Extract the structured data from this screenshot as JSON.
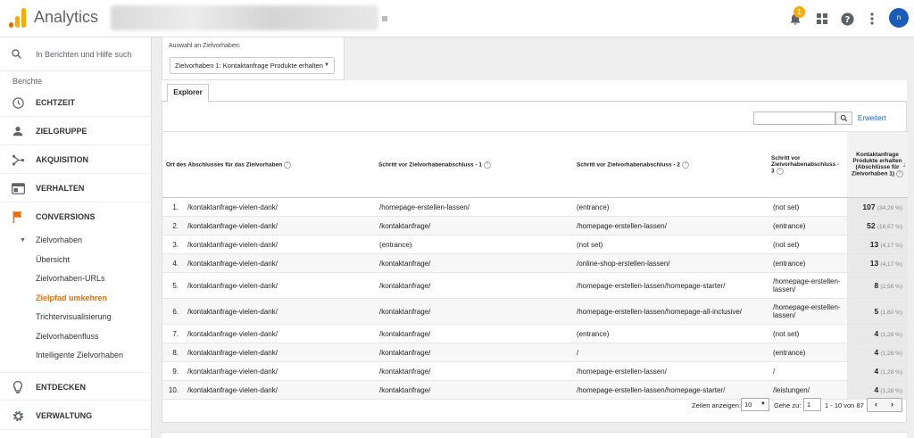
{
  "header": {
    "app_title": "Analytics",
    "notification_count": "1",
    "avatar_text": "n"
  },
  "sidebar": {
    "search_placeholder": "In Berichten und Hilfe such",
    "section_label": "Berichte",
    "items": [
      {
        "label": "ECHTZEIT",
        "icon": "clock-icon"
      },
      {
        "label": "ZIELGRUPPE",
        "icon": "person-icon"
      },
      {
        "label": "AKQUISITION",
        "icon": "acquisition-icon"
      },
      {
        "label": "VERHALTEN",
        "icon": "behavior-icon"
      },
      {
        "label": "CONVERSIONS",
        "icon": "flag-icon"
      }
    ],
    "conversions_sub": {
      "group_label": "Zielvorhaben",
      "items": [
        "Übersicht",
        "Zielvorhaben-URLs",
        "Zielpfad umkehren",
        "Trichtervisualisierung",
        "Zielvorhabenfluss",
        "Intelligente Zielvorhaben"
      ],
      "active_index": 2
    },
    "bottom_items": [
      {
        "label": "ENTDECKEN",
        "icon": "lightbulb-icon"
      },
      {
        "label": "VERWALTUNG",
        "icon": "gear-icon"
      }
    ]
  },
  "goal_selector": {
    "label": "Auswahl an Zielvorhaben:",
    "value": "Zielvorhaben 1: Kontaktanfrage Produkte erhalten"
  },
  "tabs": {
    "explorer": "Explorer"
  },
  "table_tools": {
    "advanced_link": "Erweitert"
  },
  "table": {
    "columns": [
      "Ort des Abschlusses für das Zielvorhaben",
      "Schritt vor Zielvorhabenabschluss - 1",
      "Schritt vor Zielvorhabenabschluss - 2",
      "Schritt vor Zielvorhabenabschluss - 3",
      "Kontaktanfrage Produkte erhalten (Abschlüsse für Zielvorhaben 1)"
    ],
    "rows": [
      {
        "idx": "1.",
        "c1": "/kontaktanfrage-vielen-dank/",
        "c2": "/homepage-erstellen-lassen/",
        "c3": "(entrance)",
        "c4": "(not set)",
        "value": "107",
        "pct": "(34,29 %)"
      },
      {
        "idx": "2.",
        "c1": "/kontaktanfrage-vielen-dank/",
        "c2": "/kontaktanfrage/",
        "c3": "/homepage-erstellen-lassen/",
        "c4": "(entrance)",
        "value": "52",
        "pct": "(16,67 %)"
      },
      {
        "idx": "3.",
        "c1": "/kontaktanfrage-vielen-dank/",
        "c2": "(entrance)",
        "c3": "(not set)",
        "c4": "(not set)",
        "value": "13",
        "pct": "(4,17 %)"
      },
      {
        "idx": "4.",
        "c1": "/kontaktanfrage-vielen-dank/",
        "c2": "/kontaktanfrage/",
        "c3": "/online-shop-erstellen-lassen/",
        "c4": "(entrance)",
        "value": "13",
        "pct": "(4,17 %)"
      },
      {
        "idx": "5.",
        "c1": "/kontaktanfrage-vielen-dank/",
        "c2": "/kontaktanfrage/",
        "c3": "/homepage-erstellen-lassen/homepage-starter/",
        "c4": "/homepage-erstellen-lassen/",
        "value": "8",
        "pct": "(2,56 %)"
      },
      {
        "idx": "6.",
        "c1": "/kontaktanfrage-vielen-dank/",
        "c2": "/kontaktanfrage/",
        "c3": "/homepage-erstellen-lassen/homepage-all-inclusive/",
        "c4": "/homepage-erstellen-lassen/",
        "value": "5",
        "pct": "(1,60 %)"
      },
      {
        "idx": "7.",
        "c1": "/kontaktanfrage-vielen-dank/",
        "c2": "/kontaktanfrage/",
        "c3": "(entrance)",
        "c4": "(not set)",
        "value": "4",
        "pct": "(1,28 %)"
      },
      {
        "idx": "8.",
        "c1": "/kontaktanfrage-vielen-dank/",
        "c2": "/kontaktanfrage/",
        "c3": "/",
        "c4": "(entrance)",
        "value": "4",
        "pct": "(1,28 %)"
      },
      {
        "idx": "9.",
        "c1": "/kontaktanfrage-vielen-dank/",
        "c2": "/kontaktanfrage/",
        "c3": "/homepage-erstellen-lassen/",
        "c4": "/",
        "value": "4",
        "pct": "(1,28 %)"
      },
      {
        "idx": "10.",
        "c1": "/kontaktanfrage-vielen-dank/",
        "c2": "/kontaktanfrage/",
        "c3": "/homepage-erstellen-lassen/homepage-starter/",
        "c4": "/leistungen/",
        "value": "4",
        "pct": "(1,28 %)"
      }
    ]
  },
  "pagination": {
    "rows_label": "Zeilen anzeigen:",
    "rows_value": "10",
    "goto_label": "Gehe zu:",
    "goto_value": "1",
    "range": "1 - 10 von 87"
  }
}
